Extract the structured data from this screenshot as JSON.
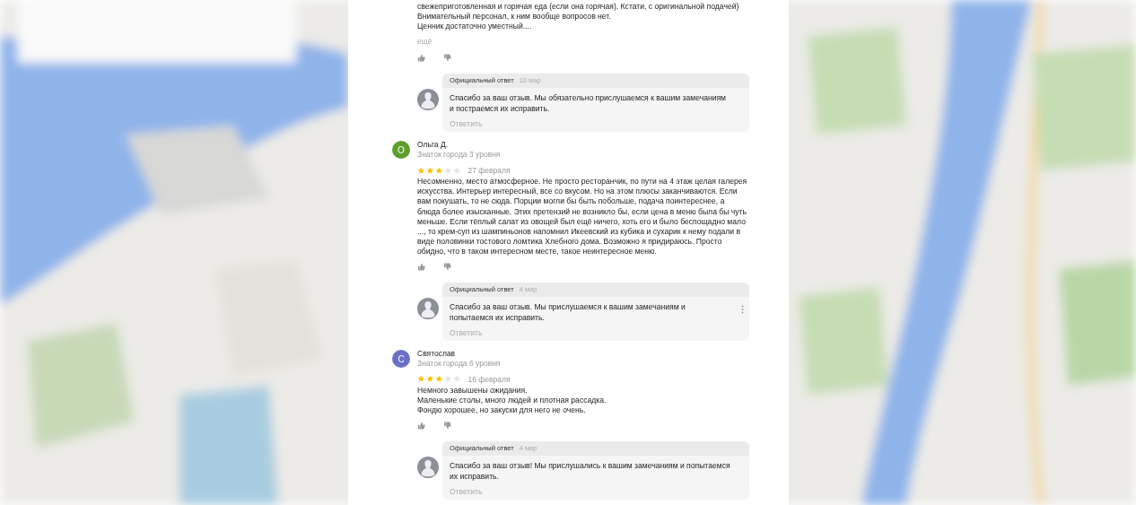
{
  "reviews": [
    {
      "text": "свежеприготовленная и горячая еда (если она горячая). Кстати, с оригинальной подачей)\nВнимательный персонал, к ним вообще вопросов нет.\nЦенник достаточно уместный....",
      "more": "ещё",
      "reply": {
        "label": "Официальный ответ",
        "date": "10 мар",
        "text": "Спасибо за ваш отзыв. Мы обязательно прислушаемся к вашим замечаниям\nи постраемся их исправить.",
        "action": "Ответить",
        "menu": false
      }
    },
    {
      "author": "Ольга Д.",
      "initial": "О",
      "color": "#5d9f2c",
      "level": "Знаток города 3 уровня",
      "stars": 3,
      "date": "27 февраля",
      "text": "Несомненно, место атмосферное. Не просто ресторанчик, по пути на 4 этаж целая галерея искусства. Интерьер интересный, все со вкусом. Но на этом плюсы заканчиваются. Если вам покушать, то не сюда. Порции могли бы быть побольше, подача поинтереснее, а блюда более изысканные. Этих претензий не возникло бы, если цена в меню была бы чуть меньше. Если тёплый салат из овощей был ещё ничего, хоть его и было беспощадно мало ..., то крем-суп из шампиньонов напомнил Икеевский из кубика и сухарик к нему подали в виде половинки тостового ломтика Хлебного дома. Возможно я придираюсь. Просто обидно, что в таком интересном месте, такое неинтересное меню.",
      "reply": {
        "label": "Официальный ответ",
        "date": "4 мар",
        "text": "Спасибо за ваш отзыв. Мы прислушаемся к вашим замечаниям и\nпопытаемся их исправить.",
        "action": "Ответить",
        "menu": true
      }
    },
    {
      "author": "Святослав",
      "initial": "С",
      "color": "#6b70c6",
      "level": "Знаток города 6 уровня",
      "stars": 3,
      "date": "16 февраля",
      "text": "Немного завышены ожидания.\nМаленькие столы, много людей и плотная рассадка.\nФондю хорошее, но закуски для него не очень.",
      "reply": {
        "label": "Официальный ответ",
        "date": "4 мар",
        "text": "Спасибо за ваш отзыв! Мы прислушались к вашим замечаниям и попытаемся\nих исправить.",
        "action": "Ответить",
        "menu": false
      }
    }
  ]
}
